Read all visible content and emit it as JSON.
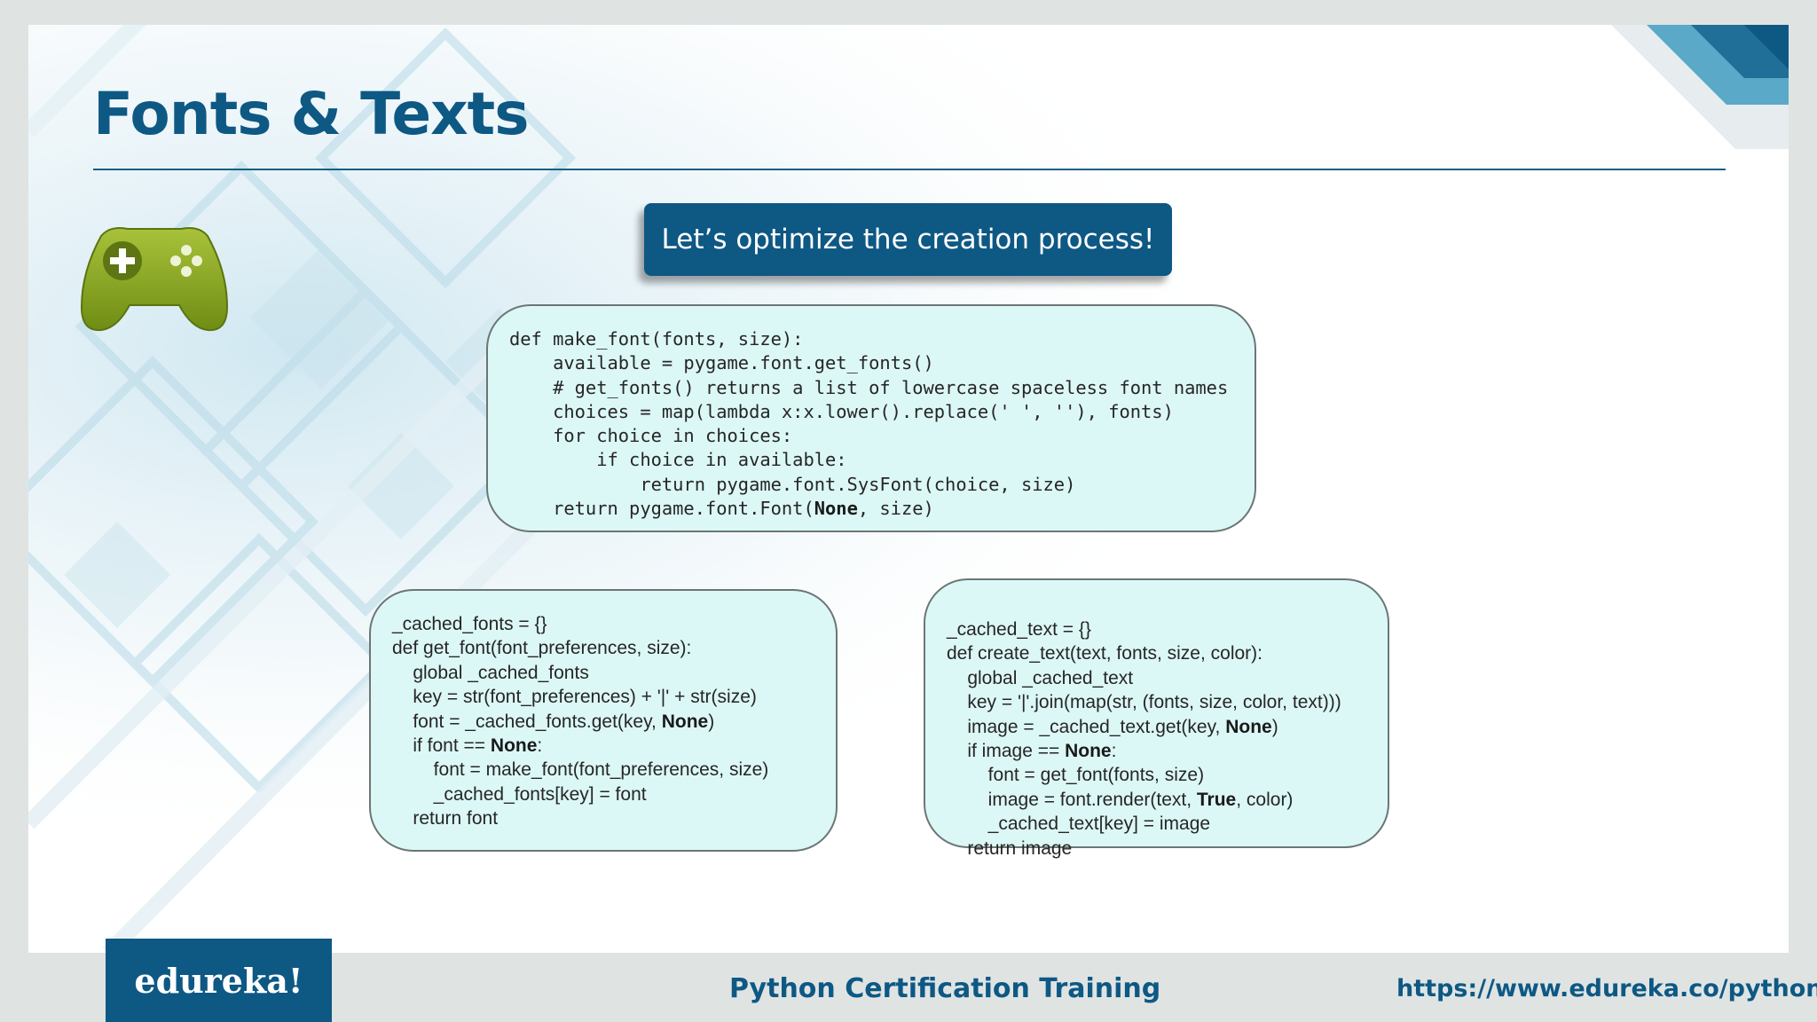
{
  "slide": {
    "title": "Fonts & Texts",
    "banner": "Let’s optimize the creation process!",
    "gamepad_icon": "game-controller-icon",
    "code_top": [
      [
        {
          "t": "def make_font(fonts, size):"
        }
      ],
      [
        {
          "t": "    available = pygame.font.get_fonts()"
        }
      ],
      [
        {
          "t": "    # get_fonts() returns a list of lowercase spaceless font names"
        }
      ],
      [
        {
          "t": "    choices = map(lambda x:x.lower().replace(' ', ''), fonts)"
        }
      ],
      [
        {
          "t": "    for choice in choices:"
        }
      ],
      [
        {
          "t": "        if choice in available:"
        }
      ],
      [
        {
          "t": "            return pygame.font.SysFont(choice, size)"
        }
      ],
      [
        {
          "t": "    return pygame.font.Font("
        },
        {
          "t": "None",
          "b": true
        },
        {
          "t": ", size)"
        }
      ]
    ],
    "code_left": [
      [
        {
          "t": "_cached_fonts = {}"
        }
      ],
      [
        {
          "t": "def get_font(font_preferences, size):"
        }
      ],
      [
        {
          "t": "    global _cached_fonts"
        }
      ],
      [
        {
          "t": "    key = str(font_preferences) + '|' + str(size)"
        }
      ],
      [
        {
          "t": "    font = _cached_fonts.get(key, "
        },
        {
          "t": "None",
          "b": true
        },
        {
          "t": ")"
        }
      ],
      [
        {
          "t": "    if font == "
        },
        {
          "t": "None",
          "b": true
        },
        {
          "t": ":"
        }
      ],
      [
        {
          "t": "        font = make_font(font_preferences, size)"
        }
      ],
      [
        {
          "t": "        _cached_fonts[key] = font"
        }
      ],
      [
        {
          "t": "    return font"
        }
      ]
    ],
    "code_right": [
      [
        {
          "t": "_cached_text = {}"
        }
      ],
      [
        {
          "t": "def create_text(text, fonts, size, color):"
        }
      ],
      [
        {
          "t": "    global _cached_text"
        }
      ],
      [
        {
          "t": "    key = '|'.join(map(str, (fonts, size, color, text)))"
        }
      ],
      [
        {
          "t": "    image = _cached_text.get(key, "
        },
        {
          "t": "None",
          "b": true
        },
        {
          "t": ")"
        }
      ],
      [
        {
          "t": "    if image == "
        },
        {
          "t": "None",
          "b": true
        },
        {
          "t": ":"
        }
      ],
      [
        {
          "t": "        font = get_font(fonts, size)"
        }
      ],
      [
        {
          "t": "        image = font.render(text, "
        },
        {
          "t": "True",
          "b": true
        },
        {
          "t": ", color)"
        }
      ],
      [
        {
          "t": "        _cached_text[key] = image"
        }
      ],
      [
        {
          "t": "    return image"
        }
      ]
    ]
  },
  "footer": {
    "logo": "edureka!",
    "course": "Python Certification Training",
    "url": "https://www.edureka.co/python"
  },
  "colors": {
    "brand_blue": "#0e5884",
    "code_box_bg": "#dcf8f6",
    "gamepad_green": "#8fae26"
  }
}
